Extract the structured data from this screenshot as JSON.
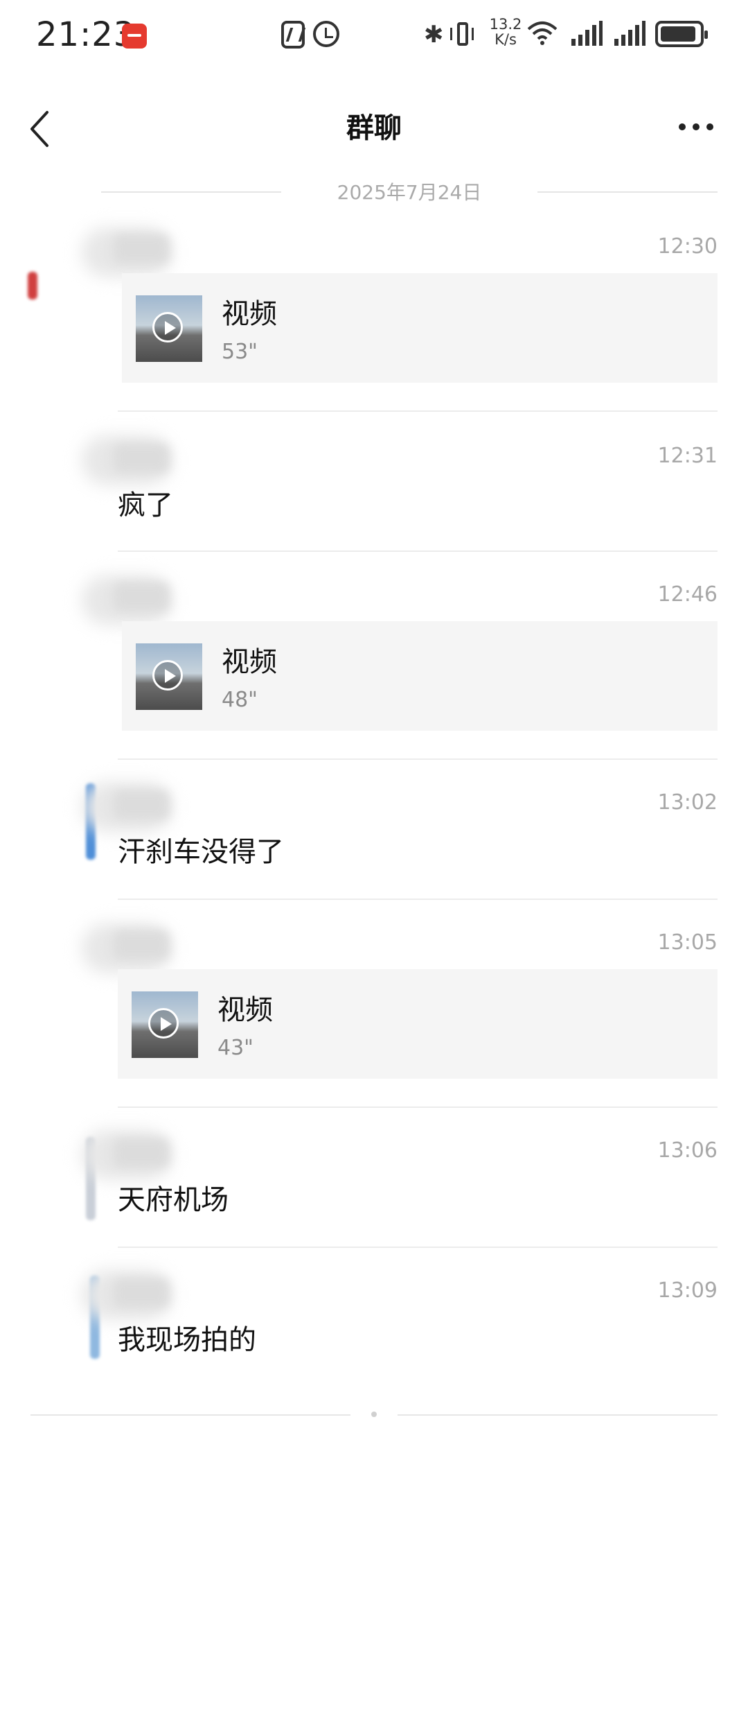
{
  "status_bar": {
    "time": "21:23",
    "net_speed_value": "13.2",
    "net_speed_unit": "K/s",
    "icons": [
      "app-notification-icon",
      "nfc-icon",
      "alarm-icon",
      "bluetooth-icon",
      "vibrate-icon",
      "wifi-icon",
      "signal-icon",
      "signal-icon",
      "battery-icon"
    ]
  },
  "header": {
    "title": "群聊",
    "icons": [
      "back-arrow-icon",
      "more-icon"
    ]
  },
  "date_separator": "2025年7月24日",
  "messages": [
    {
      "time": "12:30",
      "type": "video",
      "label": "视频",
      "duration": "53\""
    },
    {
      "time": "12:31",
      "type": "text",
      "text": "疯了"
    },
    {
      "time": "12:46",
      "type": "video",
      "label": "视频",
      "duration": "48\""
    },
    {
      "time": "13:02",
      "type": "text",
      "text": "汗刹车没得了"
    },
    {
      "time": "13:05",
      "type": "video",
      "label": "视频",
      "duration": "43\""
    },
    {
      "time": "13:06",
      "type": "text",
      "text": "天府机场"
    },
    {
      "time": "13:09",
      "type": "text",
      "text": "我现场拍的"
    }
  ],
  "colors": {
    "background": "#ffffff",
    "card": "#f5f5f5",
    "muted_text": "#a8a8a8",
    "text": "#111111"
  }
}
